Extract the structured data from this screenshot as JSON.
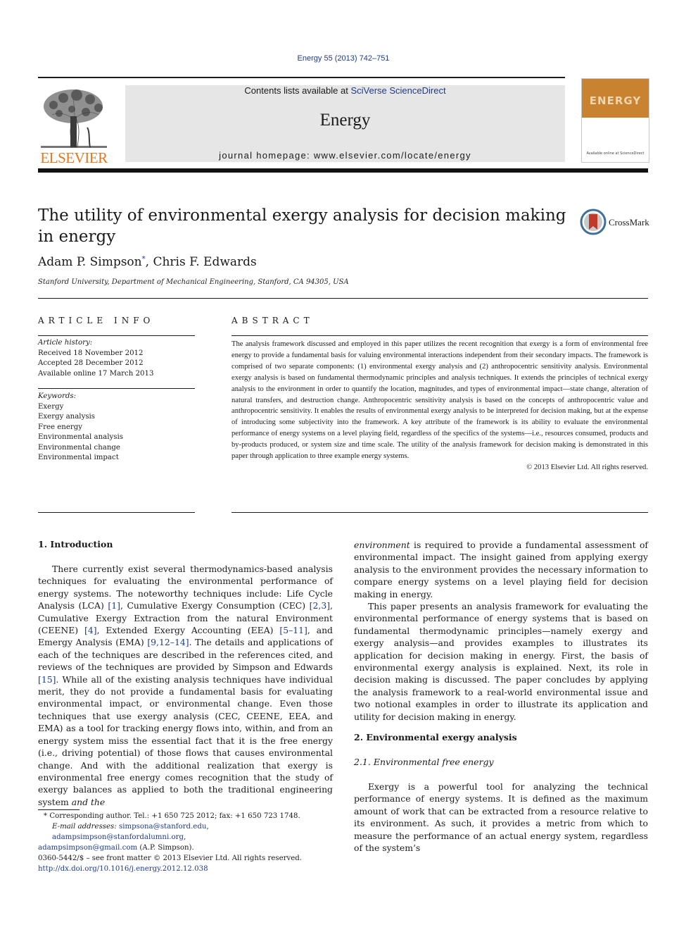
{
  "header": {
    "citation": "Energy 55 (2013) 742–751",
    "contents_prefix": "Contents lists available at ",
    "contents_link": "SciVerse ScienceDirect",
    "journal_name": "Energy",
    "homepage": "journal homepage: www.elsevier.com/locate/energy",
    "publisher_logo": "ELSEVIER",
    "cover_title": "ENERGY",
    "cover_footer": "Available online at ScienceDirect",
    "colors": {
      "elsevier_orange": "#e5761d",
      "cover_orange": "#c9822f",
      "link_blue": "#1f3b8c"
    }
  },
  "article": {
    "title": "The utility of environmental exergy analysis for decision making in energy",
    "crossmark_label": "CrossMark",
    "authors": [
      {
        "name": "Adam P. Simpson",
        "marker": "*"
      },
      {
        "name": "Chris F. Edwards",
        "marker": ""
      }
    ],
    "author_separator": ", ",
    "affiliation": "Stanford University, Department of Mechanical Engineering, Stanford, CA 94305, USA"
  },
  "article_info": {
    "heading": "ARTICLE INFO",
    "history_label": "Article history:",
    "history": [
      "Received 18 November 2012",
      "Accepted 28 December 2012",
      "Available online 17 March 2013"
    ],
    "keywords_label": "Keywords:",
    "keywords": [
      "Exergy",
      "Exergy analysis",
      "Free energy",
      "Environmental analysis",
      "Environmental change",
      "Environmental impact"
    ]
  },
  "abstract": {
    "heading": "ABSTRACT",
    "text": "The analysis framework discussed and employed in this paper utilizes the recent recognition that exergy is a form of environmental free energy to provide a fundamental basis for valuing environmental interactions independent from their secondary impacts. The framework is comprised of two separate components: (1) environmental exergy analysis and (2) anthropocentric sensitivity analysis. Environmental exergy analysis is based on fundamental thermodynamic principles and analysis techniques. It extends the principles of technical exergy analysis to the environment in order to quantify the location, magnitudes, and types of environmental impact—state change, alteration of natural transfers, and destruction change. Anthropocentric sensitivity analysis is based on the concepts of anthropocentric value and anthropocentric sensitivity. It enables the results of environmental exergy analysis to be interpreted for decision making, but at the expense of introducing some subjectivity into the framework. A key attribute of the framework is its ability to evaluate the environmental performance of energy systems on a level playing field, regardless of the specifics of the systems—i.e., resources consumed, products and by-products produced, or system size and time scale. The utility of the analysis framework for decision making is demonstrated in this paper through application to three example energy systems.",
    "copyright": "© 2013 Elsevier Ltd. All rights reserved."
  },
  "sections": {
    "intro_heading": "1.  Introduction",
    "intro_p1": {
      "t1": "There currently exist several thermodynamics-based analysis techniques for evaluating the environmental performance of energy systems. The noteworthy techniques include: Life Cycle Analysis (LCA) ",
      "r1": "[1]",
      "t2": ", Cumulative Exergy Consumption (CEC) ",
      "r2": "[2,3]",
      "t3": ", Cumulative Exergy Extraction from the natural Environment (CEENE) ",
      "r3": "[4]",
      "t4": ", Extended Exergy Accounting (EEA) ",
      "r4": "[5–11]",
      "t5": ", and Emergy Analysis (EMA) ",
      "r5": "[9,12–14]",
      "t6": ". The details and applications of each of the techniques are described in the references cited, and reviews of the techniques are provided by Simpson and Edwards ",
      "r6": "[15]",
      "t7": ". While all of the existing analysis techniques have individual merit, they do not provide a fundamental basis for evaluating environmental impact, or environmental change. Even those techniques that use exergy analysis (CEC, CEENE, EEA, and EMA) as a tool for tracking energy flows into, within, and from an energy system miss the essential fact that it is the free energy (i.e., driving potential) of those flows that causes environmental change. And with the additional realization that exergy is environmental free energy comes recognition that the study of exergy balances as applied to both the traditional engineering system ",
      "t8_italic": "and the environment",
      "t9": " is required to provide a fundamental assessment of environmental impact. The insight gained from applying exergy analysis to the environment provides the necessary information to compare energy systems on a level playing field for decision making in energy."
    },
    "intro_p2": "This paper presents an analysis framework for evaluating the environmental performance of energy systems that is based on fundamental thermodynamic principles—namely exergy and exergy analysis—and provides examples to illustrates its application for decision making in energy. First, the basis of environmental exergy analysis is explained. Next, its role in decision making is discussed. The paper concludes by applying the analysis framework to a real-world environmental issue and two notional examples in order to illustrate its application and utility for decision making in energy.",
    "left_col_end": "as applied to both the traditional engineering system ",
    "left_col_italic": "and the",
    "right_col_italic": "environment",
    "right_col_cont": " is required to provide a fundamental assessment of environmental impact. The insight gained from applying exergy analysis to the environment provides the necessary information to compare energy systems on a level playing field for decision making in energy.",
    "sec2_heading": "2.  Environmental exergy analysis",
    "sec21_heading": "2.1.  Environmental free energy",
    "sec21_p1": "Exergy is a powerful tool for analyzing the technical performance of energy systems. It is defined as the maximum amount of work that can be extracted from a resource relative to its environment. As such, it provides a metric from which to measure the performance of an actual energy system, regardless of the system’s"
  },
  "footnote": {
    "marker": "*",
    "corresponding": " Corresponding author. Tel.: +1 650 725 2012; fax: +1 650 723 1748.",
    "email_label": "E-mail addresses:",
    "emails": [
      "simpsona@stanford.edu",
      "adampsimpson@stanfordalumni.org",
      "adampsimpson@gmail.com"
    ],
    "email_owner": " (A.P. Simpson)."
  },
  "front_matter": {
    "issn_line": "0360-5442/$ – see front matter © 2013 Elsevier Ltd. All rights reserved.",
    "doi": "http://dx.doi.org/10.1016/j.energy.2012.12.038"
  }
}
